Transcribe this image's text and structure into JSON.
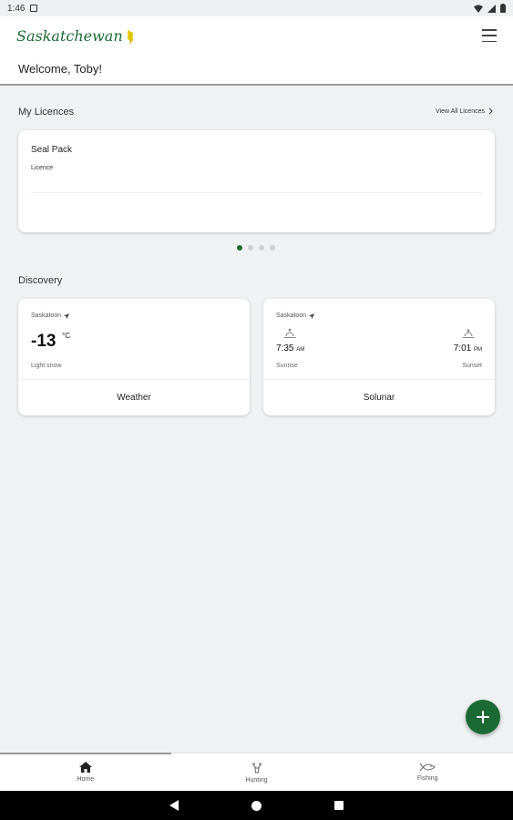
{
  "status_bar": {
    "time": "1:46"
  },
  "header": {
    "logo_text": "Saskatchewan",
    "welcome": "Welcome, Toby!"
  },
  "licences": {
    "section_title": "My Licences",
    "view_all": "View All Licences",
    "card": {
      "title": "Seal Pack",
      "subtitle": "Licence"
    },
    "pager": {
      "total": 4,
      "active": 0
    }
  },
  "discovery": {
    "section_title": "Discovery",
    "weather": {
      "location": "Saskatoon",
      "temperature": "-13",
      "unit": "°C",
      "condition": "Light snow",
      "label": "Weather"
    },
    "solunar": {
      "location": "Saskatoon",
      "sunrise_time": "7:35",
      "sunrise_ampm": "AM",
      "sunrise_label": "Sunrise",
      "sunset_time": "7:01",
      "sunset_ampm": "PM",
      "sunset_label": "Sunset",
      "label": "Solunar"
    }
  },
  "bottom_nav": {
    "items": [
      {
        "label": "Home"
      },
      {
        "label": "Hunting"
      },
      {
        "label": "Fishing"
      }
    ],
    "active": "Home"
  },
  "colors": {
    "brand_green": "#1b6a34",
    "background": "#f0f1f2"
  }
}
